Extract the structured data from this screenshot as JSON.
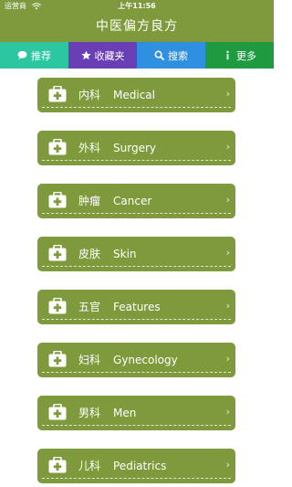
{
  "status_bar": {
    "carrier": "运营商",
    "time": "上午11:56"
  },
  "app": {
    "title": "中医偏方良方"
  },
  "tabs": [
    {
      "label": "推荐",
      "icon": "chat-bubble-icon"
    },
    {
      "label": "收藏夹",
      "icon": "star-icon"
    },
    {
      "label": "搜索",
      "icon": "search-icon"
    },
    {
      "label": "更多",
      "icon": "info-icon"
    }
  ],
  "categories": [
    {
      "zh": "内科",
      "en": "Medical"
    },
    {
      "zh": "外科",
      "en": "Surgery"
    },
    {
      "zh": "肿瘤",
      "en": "Cancer"
    },
    {
      "zh": "皮肤",
      "en": "Skin"
    },
    {
      "zh": "五官",
      "en": "Features"
    },
    {
      "zh": "妇科",
      "en": "Gynecology"
    },
    {
      "zh": "男科",
      "en": "Men"
    },
    {
      "zh": "儿科",
      "en": "Pediatrics"
    }
  ],
  "chevron": "›",
  "colors": {
    "header": "#7e9a3d",
    "card": "#7e9a3d",
    "tab_recommend": "#2cc6a1",
    "tab_favorites": "#6a3fb5",
    "tab_search": "#2f8fe0",
    "tab_more": "#1f9a41"
  }
}
